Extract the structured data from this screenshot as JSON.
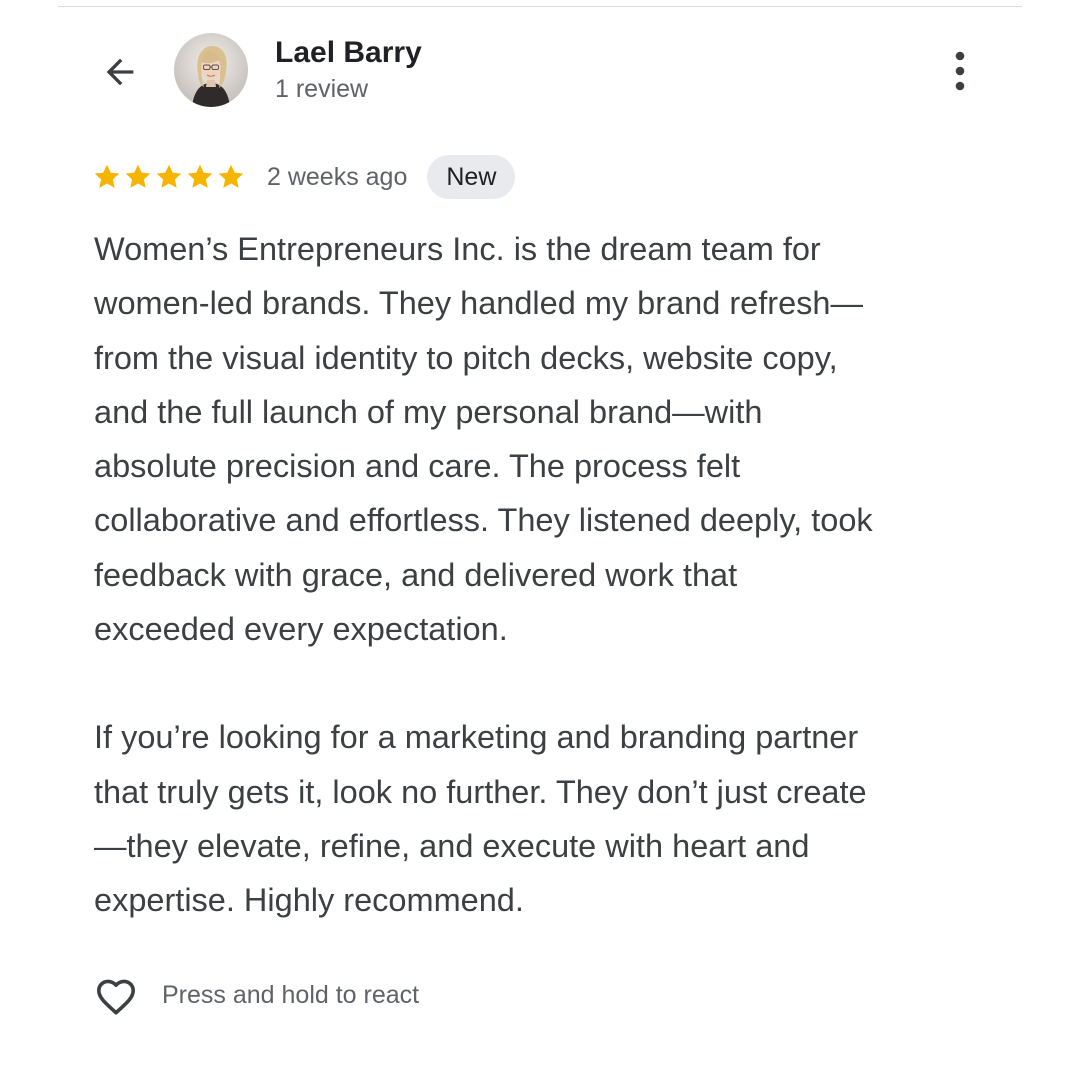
{
  "header": {
    "back_icon": "arrow-left-icon",
    "reviewer_name": "Lael Barry",
    "review_count": "1 review",
    "more_icon": "more-vertical-icon"
  },
  "rating": {
    "stars": 5,
    "max_stars": 5,
    "star_color": "#F4B400",
    "time_ago": "2 weeks ago",
    "badge": "New"
  },
  "review": {
    "paragraph_1": "Women’s Entrepreneurs Inc. is the dream team for\nwomen-led brands. They handled my brand refresh—\nfrom the visual identity to pitch decks, website copy,\nand the full launch of my personal brand—with\nabsolute precision and care. The process felt\ncollaborative and effortless. They listened deeply, took\nfeedback with grace, and delivered work that\nexceeded every expectation.",
    "paragraph_2": "If you’re looking for a marketing and branding partner\nthat truly gets it, look no further. They don’t just create\n—they elevate, refine, and execute with heart and\nexpertise. Highly recommend."
  },
  "reaction": {
    "heart_icon": "heart-outline-icon",
    "hint": "Press and hold to react"
  }
}
